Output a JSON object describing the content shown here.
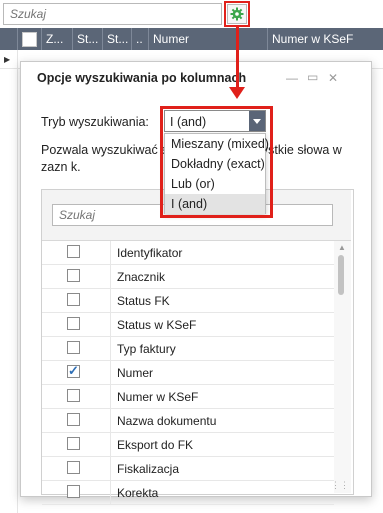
{
  "search": {
    "placeholder": "Szukaj"
  },
  "grid": {
    "columns": [
      "Z...",
      "St...",
      "St...",
      "..",
      "Numer",
      "Numer w KSeF"
    ]
  },
  "dialog": {
    "title": "Opcje wyszukiwania po kolumnach",
    "mode_label": "Tryb wyszukiwania:",
    "mode_value": "I (and)",
    "description": "Pozwala wyszukiwać ele                              występują wszystkie słowa w zazn                              k.",
    "options": [
      "Mieszany (mixed)",
      "Dokładny (exact)",
      "Lub (or)",
      "I (and)"
    ],
    "list_search_placeholder": "Szukaj",
    "columns_list": [
      {
        "label": "Identyfikator",
        "checked": false
      },
      {
        "label": "Znacznik",
        "checked": false
      },
      {
        "label": "Status FK",
        "checked": false
      },
      {
        "label": "Status w KSeF",
        "checked": false
      },
      {
        "label": "Typ faktury",
        "checked": false
      },
      {
        "label": "Numer",
        "checked": true
      },
      {
        "label": "Numer w KSeF",
        "checked": false
      },
      {
        "label": "Nazwa dokumentu",
        "checked": false
      },
      {
        "label": "Eksport do FK",
        "checked": false
      },
      {
        "label": "Fiskalizacja",
        "checked": false
      },
      {
        "label": "Korekta",
        "checked": false
      }
    ]
  },
  "icons": {
    "gear": "gear-icon",
    "minimize": "minimize-icon",
    "maximize": "maximize-icon",
    "close": "close-icon"
  },
  "colors": {
    "header_bg": "#5b6677",
    "highlight_red": "#e0201a",
    "gear_green": "#3aa54a",
    "checkmark_blue": "#2f6fb6"
  }
}
